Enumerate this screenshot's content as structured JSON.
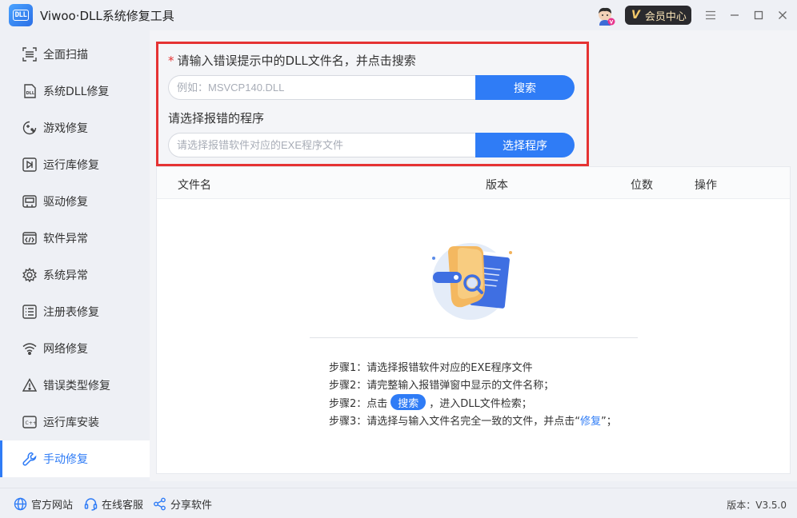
{
  "window": {
    "logo_text": "DLL",
    "title": "Viwoo·DLL系统修复工具",
    "vip_label": "会员中心",
    "vip_mark": "V"
  },
  "sidebar": {
    "items": [
      {
        "label": "全面扫描",
        "icon": "scan-icon"
      },
      {
        "label": "系统DLL修复",
        "icon": "dll-file-icon"
      },
      {
        "label": "游戏修复",
        "icon": "gamepad-icon"
      },
      {
        "label": "运行库修复",
        "icon": "runtime-icon"
      },
      {
        "label": "驱动修复",
        "icon": "driver-icon"
      },
      {
        "label": "软件异常",
        "icon": "code-window-icon"
      },
      {
        "label": "系统异常",
        "icon": "gear-icon"
      },
      {
        "label": "注册表修复",
        "icon": "list-icon"
      },
      {
        "label": "网络修复",
        "icon": "wifi-icon"
      },
      {
        "label": "错误类型修复",
        "icon": "warning-icon"
      },
      {
        "label": "运行库安装",
        "icon": "cpp-icon"
      },
      {
        "label": "手动修复",
        "icon": "wrench-icon"
      }
    ],
    "active_index": 11
  },
  "form": {
    "required_mark": "*",
    "dll_label": "请输入错误提示中的DLL文件名，并点击搜索",
    "dll_placeholder": "例如：MSVCP140.DLL",
    "search_button": "搜索",
    "program_label": "请选择报错的程序",
    "program_placeholder": "请选择报错软件对应的EXE程序文件",
    "select_button": "选择程序"
  },
  "table": {
    "columns": [
      "文件名",
      "版本",
      "位数",
      "操作"
    ]
  },
  "steps": {
    "step1": "步骤1：请选择报错软件对应的EXE程序文件",
    "step2a": "步骤2：请完整输入报错弹窗中显示的文件名称；",
    "step2b_prefix": "步骤2：点击",
    "step2b_button": "搜索",
    "step2b_suffix": "，进入DLL文件检索；",
    "step3_prefix": "步骤3：请选择与输入文件名完全一致的文件，并点击“",
    "step3_link": "修复",
    "step3_suffix": "”；"
  },
  "footer": {
    "website": "官方网站",
    "support": "在线客服",
    "share": "分享软件",
    "version": "版本：V3.5.0"
  },
  "colors": {
    "accent": "#2f7cf6",
    "highlight_border": "#e53333"
  }
}
